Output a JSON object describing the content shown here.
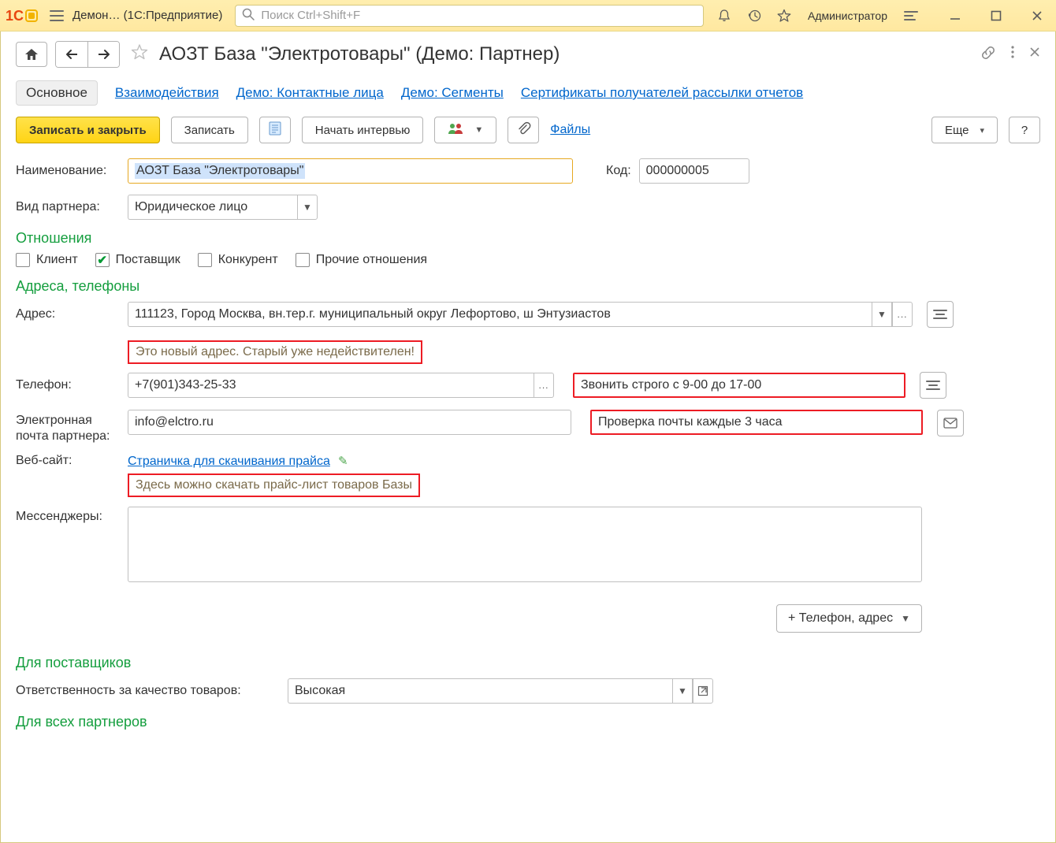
{
  "titlebar": {
    "app_caption": "Демон…  (1С:Предприятие)",
    "search_placeholder": "Поиск Ctrl+Shift+F",
    "user": "Администратор"
  },
  "header": {
    "title": "АОЗТ База \"Электротовары\" (Демо: Партнер)"
  },
  "tabs": {
    "main": "Основное",
    "interactions": "Взаимодействия",
    "contacts": "Демо: Контактные лица",
    "segments": "Демо: Сегменты",
    "certs": "Сертификаты получателей рассылки отчетов"
  },
  "cmdbar": {
    "save_close": "Записать и закрыть",
    "save": "Записать",
    "interview": "Начать интервью",
    "files": "Файлы",
    "more": "Еще",
    "help": "?"
  },
  "fields": {
    "name_label": "Наименование:",
    "name_value": "АОЗТ База \"Электротовары\"",
    "code_label": "Код:",
    "code_value": "000000005",
    "partner_type_label": "Вид партнера:",
    "partner_type_value": "Юридическое лицо"
  },
  "sections": {
    "relations_title": "Отношения",
    "chk_client": "Клиент",
    "chk_supplier": "Поставщик",
    "chk_competitor": "Конкурент",
    "chk_other": "Прочие отношения",
    "addr_title": "Адреса, телефоны"
  },
  "contacts": {
    "address_label": "Адрес:",
    "address_value": "111123, Город Москва, вн.тер.г. муниципальный округ Лефортово, ш Энтузиастов",
    "address_note": "Это новый адрес. Старый уже недействителен!",
    "phone_label": "Телефон:",
    "phone_value": "+7(901)343-25-33",
    "phone_note": "Звонить строго с 9-00 до 17-00",
    "email_label": "Электронная почта партнера:",
    "email_value": "info@elctro.ru",
    "email_note": "Проверка почты каждые 3 часа",
    "web_label": "Веб-сайт:",
    "web_link_text": "Страничка для скачивания прайса",
    "web_note": "Здесь можно скачать прайс-лист товаров Базы",
    "mess_label": "Мессенджеры:",
    "add_contact_btn": "+ Телефон, адрес"
  },
  "suppliers": {
    "title": "Для поставщиков",
    "quality_label": "Ответственность за качество товаров:",
    "quality_value": "Высокая"
  },
  "all_partners_title": "Для всех партнеров"
}
